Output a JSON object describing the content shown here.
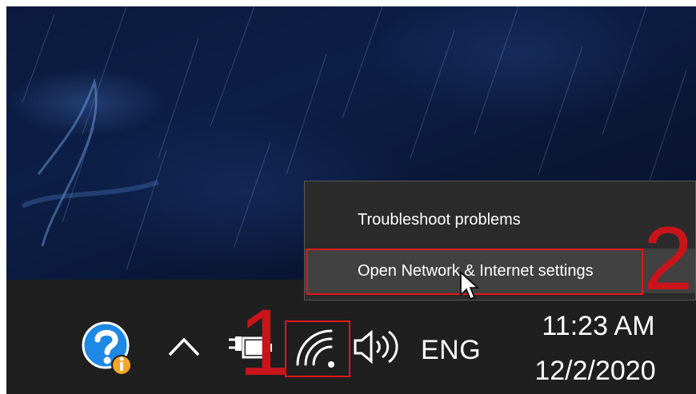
{
  "context_menu": {
    "items": [
      {
        "label": "Troubleshoot problems"
      },
      {
        "label": "Open Network & Internet settings"
      }
    ]
  },
  "annotations": {
    "step_1": "1",
    "step_2": "2",
    "color": "#c8141a"
  },
  "tray": {
    "icons": [
      "help-info-icon",
      "chevron-up-icon",
      "power-plug-battery-icon",
      "wifi-icon",
      "volume-icon"
    ],
    "language": "ENG",
    "time": "11:23 AM",
    "date": "12/2/2020"
  },
  "colors": {
    "taskbar": "#1f1f1f",
    "menu": "#2b2b2b",
    "menu_hover": "#414141",
    "highlight": "#e0171b"
  }
}
